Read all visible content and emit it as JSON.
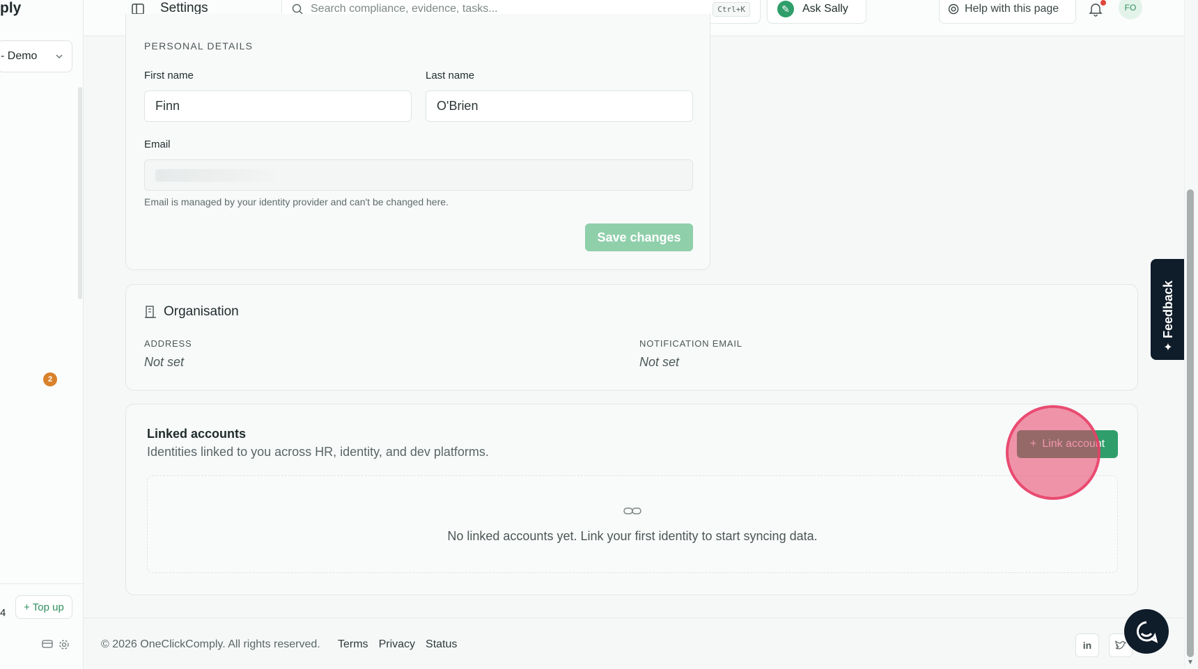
{
  "sidebar": {
    "brand": "ply",
    "org_selector": "- Demo",
    "nav_badge": "2",
    "credits": "4",
    "topup_label": "+ Top up"
  },
  "header": {
    "title": "Settings",
    "search_placeholder": "Search compliance, evidence, tasks...",
    "search_shortcut": "Ctrl+K",
    "ask_sally": "Ask Sally",
    "help": "Help with this page",
    "avatar_initials": "FO"
  },
  "personal": {
    "section_label": "PERSONAL DETAILS",
    "first_name_label": "First name",
    "first_name_value": "Finn",
    "last_name_label": "Last name",
    "last_name_value": "O'Brien",
    "email_label": "Email",
    "email_hint": "Email is managed by your identity provider and can't be changed here.",
    "save_label": "Save changes"
  },
  "organisation": {
    "title": "Organisation",
    "address_label": "ADDRESS",
    "address_value": "Not set",
    "notification_label": "NOTIFICATION EMAIL",
    "notification_value": "Not set"
  },
  "linked": {
    "title": "Linked accounts",
    "subtitle": "Identities linked to you across HR, identity, and dev platforms.",
    "button_label": "Link account",
    "empty_text": "No linked accounts yet. Link your first identity to start syncing data."
  },
  "feedback_label": "Feedback",
  "footer": {
    "copyright": "© 2026 OneClickComply. All rights reserved.",
    "links": [
      "Terms",
      "Privacy",
      "Status"
    ],
    "social_linkedin": "in"
  },
  "colors": {
    "accent": "#2f9e6a",
    "accent_disabled": "#8fcfaa",
    "badge": "#d9822b",
    "notification_dot": "#e0463a",
    "click_marker": "#e83e66",
    "feedback_bg": "#0f1c2a"
  },
  "icons": {
    "panel": "sidebar-toggle-icon",
    "search": "search-icon",
    "help": "lifebuoy-icon",
    "bell": "bell-icon",
    "org": "building-icon",
    "link": "link-icon",
    "plus": "plus-icon",
    "chat": "chat-icon"
  }
}
